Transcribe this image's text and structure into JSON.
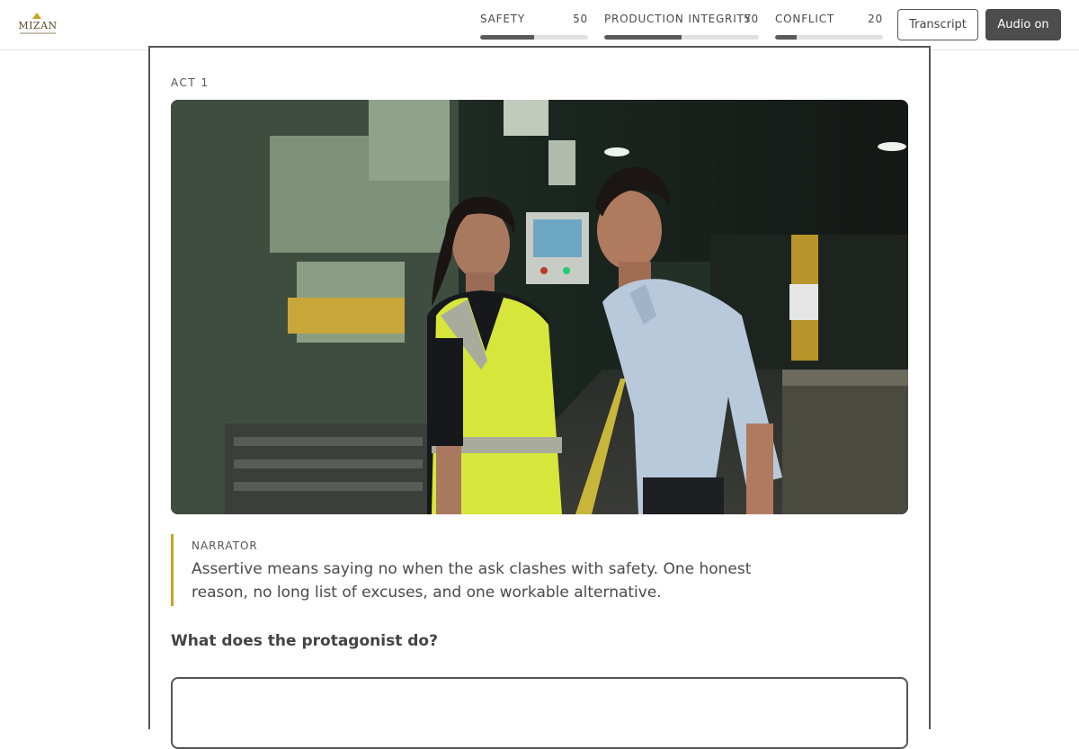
{
  "header": {
    "logo_text": "MIZAN",
    "meters": [
      {
        "label": "SAFETY",
        "value": "50",
        "level": 0.5
      },
      {
        "label": "PRODUCTION INTEGRITY",
        "value": "50",
        "level": 0.5
      },
      {
        "label": "CONFLICT",
        "value": "20",
        "level": 0.2
      }
    ],
    "transcript_label": "Transcript",
    "audio_label": "Audio on"
  },
  "scene": {
    "act_label": "ACT 1",
    "narrator_label": "NARRATOR",
    "narrator_text": "Assertive means saying no when the ask clashes with safety. One honest reason, no long list of excuses, and one workable alternative.",
    "question": "What does the protagonist do?"
  },
  "colors": {
    "accent": "#c9a227",
    "meter_fill": "#5a5a5a",
    "meter_track": "#e1e1e1",
    "vest": "#d7e63a"
  }
}
